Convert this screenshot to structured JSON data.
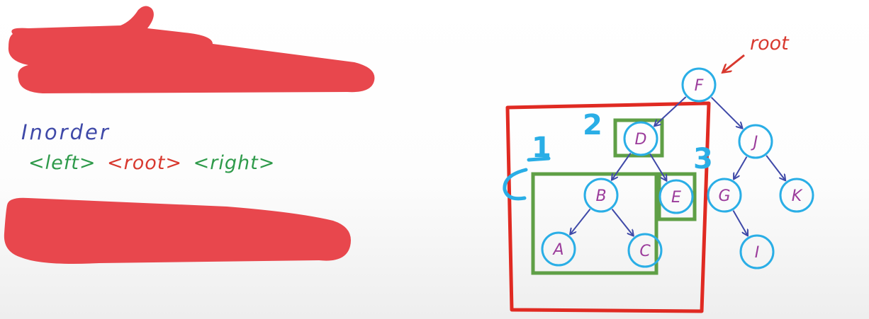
{
  "colors": {
    "background": "#fbfbfb",
    "redaction": "#e8474d",
    "title_blue": "#3f49a8",
    "green": "#2e9a4a",
    "red": "#d8382e",
    "node_ring": "#2aaee6",
    "node_letter": "#9b3c9b",
    "edge": "#3f49a8",
    "box_red": "#e02a22",
    "box_green": "#5f9f46",
    "cyan": "#2aaee6"
  },
  "heading": "Inorder",
  "rule": {
    "left": "<left>",
    "root": "<root>",
    "right": "<right>"
  },
  "root_label": "root",
  "step_numbers": [
    "1",
    "2",
    "3"
  ],
  "tree": {
    "nodes": [
      {
        "id": "F",
        "label": "F"
      },
      {
        "id": "D",
        "label": "D"
      },
      {
        "id": "J",
        "label": "J"
      },
      {
        "id": "B",
        "label": "B"
      },
      {
        "id": "E",
        "label": "E"
      },
      {
        "id": "G",
        "label": "G"
      },
      {
        "id": "K",
        "label": "K"
      },
      {
        "id": "A",
        "label": "A"
      },
      {
        "id": "C",
        "label": "C"
      },
      {
        "id": "I",
        "label": "I"
      }
    ],
    "edges": [
      [
        "F",
        "D"
      ],
      [
        "F",
        "J"
      ],
      [
        "D",
        "B"
      ],
      [
        "D",
        "E"
      ],
      [
        "B",
        "A"
      ],
      [
        "B",
        "C"
      ],
      [
        "J",
        "G"
      ],
      [
        "J",
        "K"
      ],
      [
        "G",
        "I"
      ]
    ]
  }
}
